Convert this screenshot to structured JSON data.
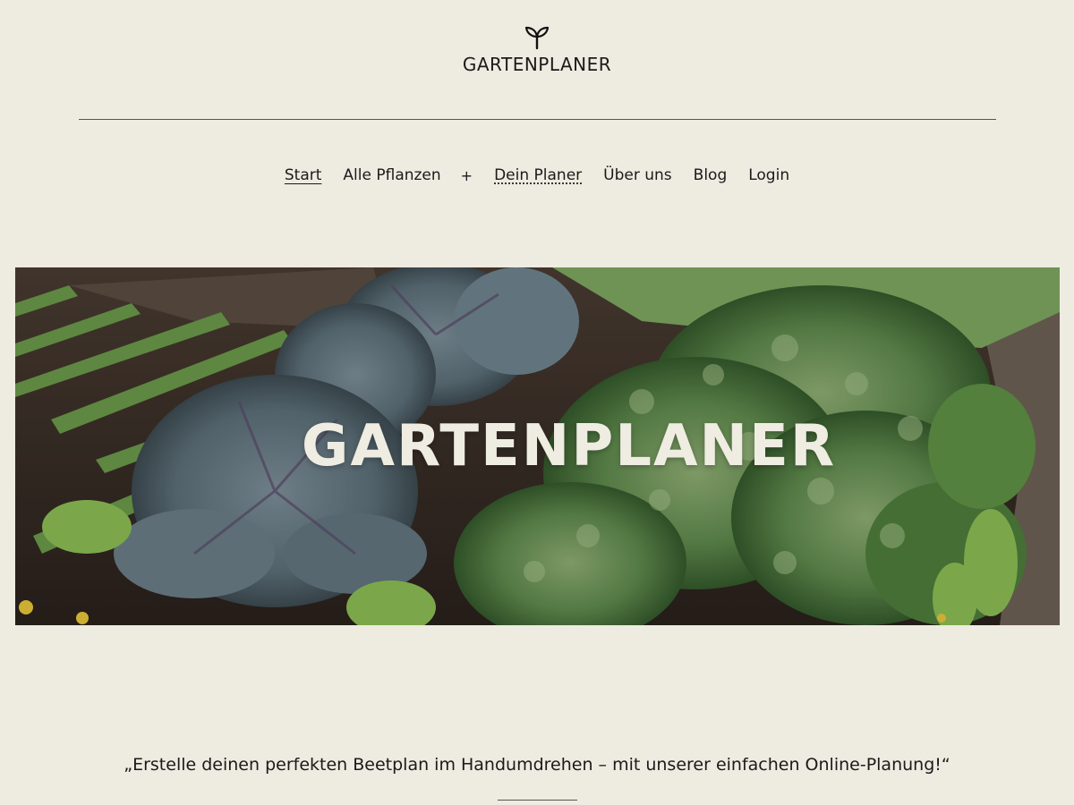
{
  "header": {
    "logo_icon": "sprout-icon",
    "site_title": "GARTENPLANER"
  },
  "nav": {
    "items": [
      {
        "label": "Start",
        "state": "current"
      },
      {
        "label": "Alle Pflanzen"
      },
      {
        "label": "+"
      },
      {
        "label": "Dein Planer"
      },
      {
        "label": "Über uns"
      },
      {
        "label": "Blog"
      },
      {
        "label": "Login"
      }
    ]
  },
  "hero": {
    "title": "GARTENPLANER"
  },
  "tagline": {
    "text": "„Erstelle deinen perfekten Beetplan im Handumdrehen – mit unserer einfachen Online-Planung!“"
  },
  "colors": {
    "background": "#eeebe1",
    "text": "#1a1a1a",
    "hero_text": "#efece2"
  }
}
